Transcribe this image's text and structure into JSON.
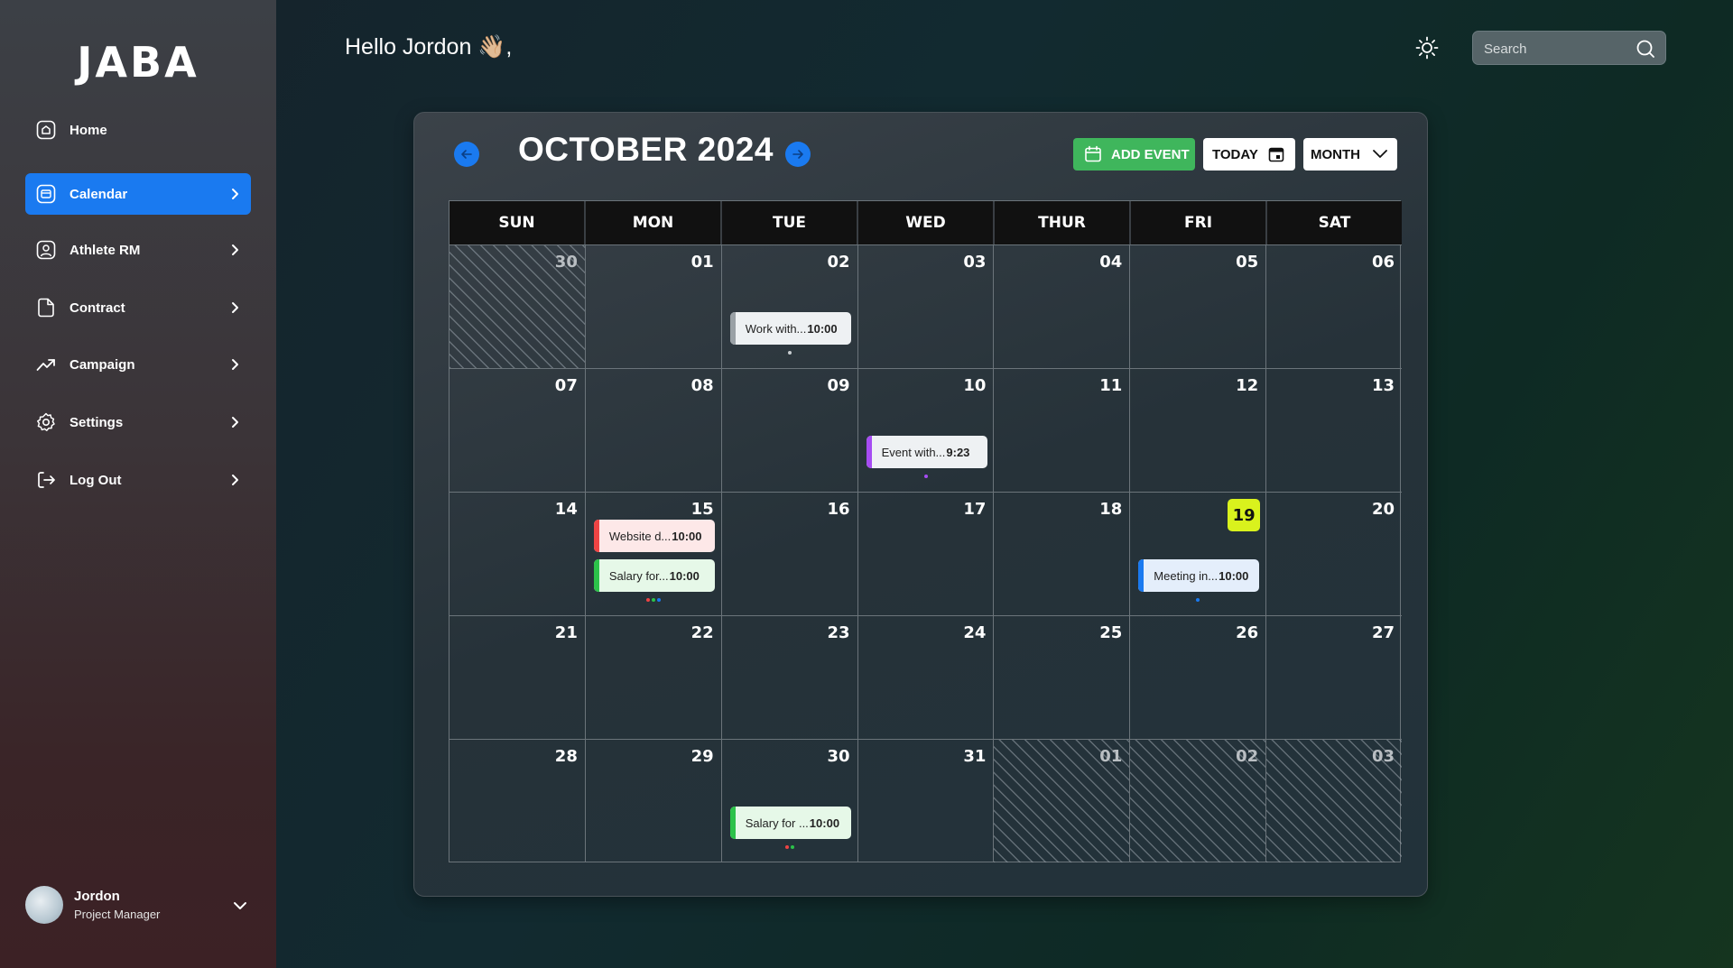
{
  "brand": {
    "name": "JABA"
  },
  "sidebar": {
    "items": [
      {
        "label": "Home",
        "icon": "home-icon",
        "active": false,
        "chevron": false
      },
      {
        "label": "Calendar",
        "icon": "calendar-icon",
        "active": true,
        "chevron": true
      },
      {
        "label": "Athlete RM",
        "icon": "user-icon",
        "active": false,
        "chevron": true
      },
      {
        "label": "Contract",
        "icon": "document-icon",
        "active": false,
        "chevron": true
      },
      {
        "label": "Campaign",
        "icon": "trending-up-icon",
        "active": false,
        "chevron": true
      },
      {
        "label": "Settings",
        "icon": "gear-icon",
        "active": false,
        "chevron": true
      },
      {
        "label": "Log Out",
        "icon": "logout-icon",
        "active": false,
        "chevron": true
      }
    ]
  },
  "user": {
    "name": "Jordon",
    "role": "Project Manager"
  },
  "header": {
    "greeting": "Hello Jordon 👋🏼,",
    "search_placeholder": "Search"
  },
  "calendar": {
    "title": "OCTOBER 2024",
    "add_event_label": "ADD EVENT",
    "today_label": "TODAY",
    "view_label": "MONTH",
    "weekdays": [
      "SUN",
      "MON",
      "TUE",
      "WED",
      "THUR",
      "FRI",
      "SAT"
    ],
    "today": "19",
    "weeks": [
      [
        {
          "day": "30",
          "out": true
        },
        {
          "day": "01"
        },
        {
          "day": "02",
          "events": [
            {
              "title": "Work with...",
              "time": "10:00",
              "color": "gray"
            }
          ],
          "dots": [
            "#c8cdd0"
          ]
        },
        {
          "day": "03"
        },
        {
          "day": "04"
        },
        {
          "day": "05"
        },
        {
          "day": "06"
        }
      ],
      [
        {
          "day": "07"
        },
        {
          "day": "08"
        },
        {
          "day": "09"
        },
        {
          "day": "10",
          "events": [
            {
              "title": "Event with...",
              "time": "9:23",
              "color": "purple"
            }
          ],
          "dots": [
            "#a64cf2"
          ]
        },
        {
          "day": "11"
        },
        {
          "day": "12"
        },
        {
          "day": "13"
        }
      ],
      [
        {
          "day": "14"
        },
        {
          "day": "15",
          "events": [
            {
              "title": "Website d...",
              "time": "10:00",
              "color": "red"
            },
            {
              "title": "Salary for...",
              "time": "10:00",
              "color": "green"
            }
          ],
          "dots": [
            "#ef4444",
            "#2cc24a",
            "#1a7af0"
          ]
        },
        {
          "day": "16"
        },
        {
          "day": "17"
        },
        {
          "day": "18"
        },
        {
          "day": "19",
          "today": true,
          "events": [
            {
              "title": "Meeting in...",
              "time": "10:00",
              "color": "blue",
              "slot": 1
            }
          ],
          "dots": [
            "#1a7af0"
          ]
        },
        {
          "day": "20"
        }
      ],
      [
        {
          "day": "21"
        },
        {
          "day": "22"
        },
        {
          "day": "23"
        },
        {
          "day": "24"
        },
        {
          "day": "25"
        },
        {
          "day": "26"
        },
        {
          "day": "27"
        }
      ],
      [
        {
          "day": "28"
        },
        {
          "day": "29"
        },
        {
          "day": "30",
          "events": [
            {
              "title": "Salary for ...",
              "time": "10:00",
              "color": "green"
            }
          ],
          "dots": [
            "#ef4444",
            "#2cc24a"
          ]
        },
        {
          "day": "31"
        },
        {
          "day": "01",
          "out": true
        },
        {
          "day": "02",
          "out": true
        },
        {
          "day": "03",
          "out": true
        }
      ]
    ]
  }
}
